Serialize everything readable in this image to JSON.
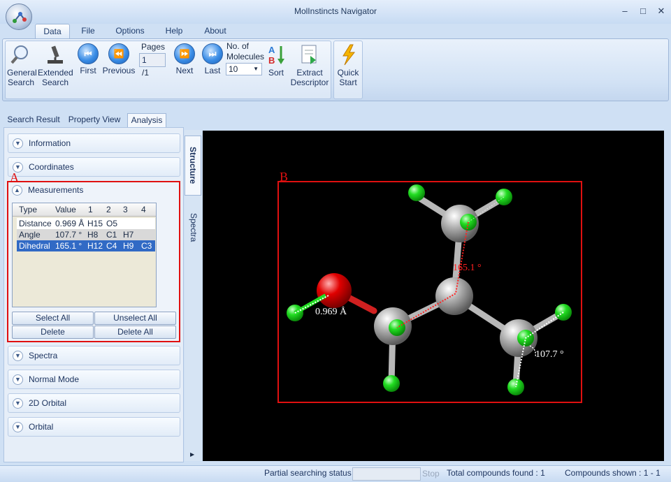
{
  "window": {
    "title": "MolInstincts Navigator",
    "minimize": "–",
    "maximize": "□",
    "close": "✕"
  },
  "menu_tabs": [
    "Data",
    "File",
    "Options",
    "Help",
    "About"
  ],
  "ribbon": {
    "general_search": [
      "General",
      "Search"
    ],
    "extended_search": [
      "Extended",
      "Search"
    ],
    "first": "First",
    "previous": "Previous",
    "pages_label": "Pages",
    "page_value": "1",
    "page_total": "/1",
    "next": "Next",
    "last": "Last",
    "molecules_label": [
      "No. of",
      "Molecules"
    ],
    "molecules_value": "10",
    "sort": "Sort",
    "extract": [
      "Extract",
      "Descriptor"
    ],
    "quick_start": [
      "Quick",
      "Start"
    ]
  },
  "view_tabs": [
    "Search Result",
    "Property View",
    "Analysis"
  ],
  "accordion": {
    "information": "Information",
    "coordinates": "Coordinates",
    "measurements": "Measurements",
    "spectra": "Spectra",
    "normal_mode": "Normal Mode",
    "orbital_2d": "2D Orbital",
    "orbital": "Orbital"
  },
  "measurements": {
    "headers": [
      "Type",
      "Value",
      "1",
      "2",
      "3",
      "4"
    ],
    "rows": [
      [
        "Distance",
        "0.969 Å",
        "H15",
        "O5",
        "",
        ""
      ],
      [
        "Angle",
        "107.7 °",
        "H8",
        "C1",
        "H7",
        ""
      ],
      [
        "Dihedral",
        "165.1 °",
        "H12",
        "C4",
        "H9",
        "C3"
      ]
    ],
    "select_all": "Select All",
    "unselect_all": "Unselect All",
    "delete": "Delete",
    "delete_all": "Delete All"
  },
  "side_tabs": {
    "structure": "Structure",
    "spectra": "Spectra"
  },
  "annotations": {
    "a": "A",
    "b": "B"
  },
  "viewer_labels": {
    "distance": "0.969 Å",
    "angle": "107.7 °",
    "dihedral": "165.1 °"
  },
  "status": {
    "partial": "Partial searching status :",
    "stop": "Stop",
    "total": "Total compounds found : 1",
    "shown": "Compounds shown : 1 - 1"
  },
  "colors": {
    "highlight": "#316ac5",
    "annotation": "#e01010",
    "oxygen": "#e00000",
    "hydrogen": "#22dd22",
    "carbon": "#a0a0a0"
  }
}
